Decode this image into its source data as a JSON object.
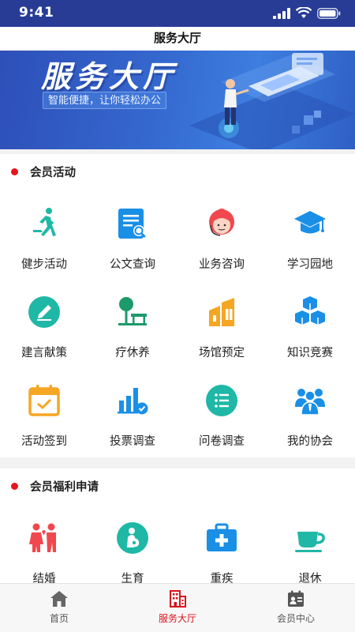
{
  "status_bar": {
    "time": "9:41"
  },
  "nav": {
    "title": "服务大厅"
  },
  "banner": {
    "title": "服务大厅",
    "subtitle": "智能便捷，让你轻松办公"
  },
  "sections": [
    {
      "title": "会员活动",
      "items": [
        {
          "label": "健步活动",
          "icon": "running-person-icon"
        },
        {
          "label": "公文查询",
          "icon": "document-search-icon"
        },
        {
          "label": "业务咨询",
          "icon": "customer-service-icon"
        },
        {
          "label": "学习园地",
          "icon": "graduation-cap-icon"
        },
        {
          "label": "建言献策",
          "icon": "pencil-icon"
        },
        {
          "label": "疗休养",
          "icon": "tree-bench-icon"
        },
        {
          "label": "场馆预定",
          "icon": "building-icon"
        },
        {
          "label": "知识竞赛",
          "icon": "cubes-icon"
        },
        {
          "label": "活动签到",
          "icon": "calendar-check-icon"
        },
        {
          "label": "投票调查",
          "icon": "bar-chart-check-icon"
        },
        {
          "label": "问卷调查",
          "icon": "checklist-icon"
        },
        {
          "label": "我的协会",
          "icon": "people-group-icon"
        }
      ]
    },
    {
      "title": "会员福利申请",
      "items": [
        {
          "label": "结婚",
          "icon": "wedding-couple-icon"
        },
        {
          "label": "生育",
          "icon": "pregnancy-icon"
        },
        {
          "label": "重疾",
          "icon": "medical-kit-icon"
        },
        {
          "label": "退休",
          "icon": "tea-cup-icon"
        }
      ]
    }
  ],
  "tabs": [
    {
      "label": "首页",
      "icon": "home-icon"
    },
    {
      "label": "服务大厅",
      "icon": "office-building-icon",
      "active": true
    },
    {
      "label": "会员中心",
      "icon": "member-card-icon"
    }
  ],
  "colors": {
    "accent": "#d9141c",
    "status_bar": "#283c96",
    "icon_blue": "#1a8fe6",
    "icon_teal": "#1fb8a6",
    "icon_orange": "#f5a623",
    "icon_red": "#f0484e"
  }
}
